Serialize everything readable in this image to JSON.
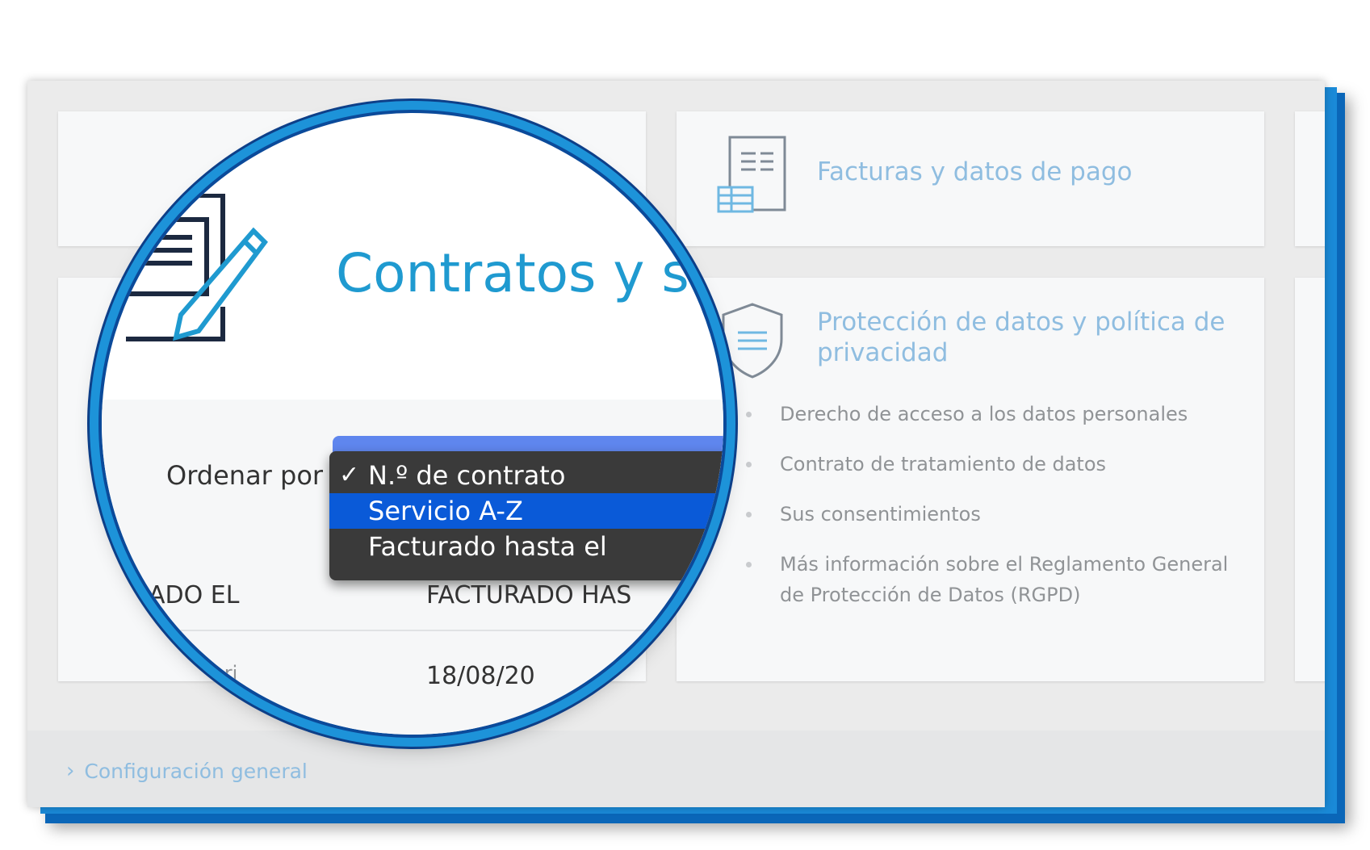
{
  "cards": {
    "contracts": {
      "title": "Contratos y sus",
      "sort_label": "Ordenar por",
      "sort_options": [
        "N.º de contrato",
        "Servicio A-Z",
        "Facturado hasta el"
      ],
      "selected_option": "N.º de contrato",
      "highlighted_option": "Servicio A-Z",
      "columns": [
        "ADO EL",
        "FACTURADO HAS"
      ],
      "rows": [
        {
          "label": "Autori",
          "date": "18/08/20"
        }
      ]
    },
    "invoices": {
      "title": "Facturas y datos de pago"
    },
    "privacy": {
      "title": "Protección de datos y política de privacidad",
      "items": [
        "Derecho de acceso a los datos personales",
        "Contrato de tratamiento de datos",
        "Sus consentimientos",
        "Más información sobre el Reglamento General de Protección de Datos (RGPD)"
      ]
    }
  },
  "footer": {
    "config_link": "Configuración general"
  },
  "colors": {
    "accent": "#1f9ad0",
    "link": "#8fbde0",
    "frame": "#0a66b8",
    "dropdown_highlight": "#0a5ad8"
  },
  "icons": {
    "contracts": "document-pen-icon",
    "invoices": "invoice-icon",
    "privacy": "shield-icon",
    "config": "chevron-right-icon",
    "check": "checkmark-icon"
  }
}
